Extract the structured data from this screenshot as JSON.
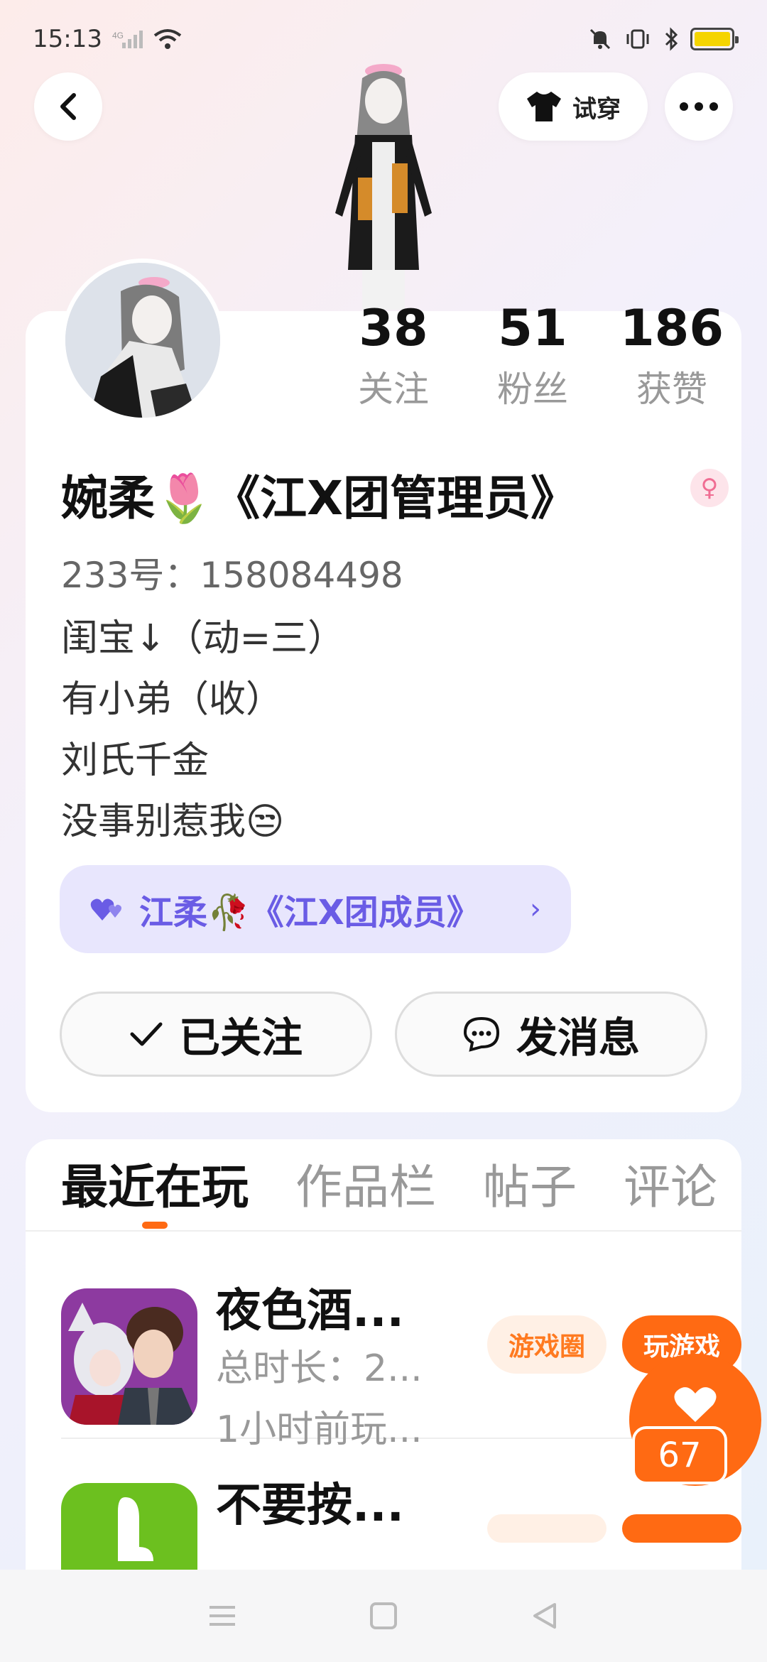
{
  "status_bar": {
    "time": "15:13"
  },
  "header": {
    "tryon_label": "试穿"
  },
  "stats": [
    {
      "value": "38",
      "label": "关注"
    },
    {
      "value": "51",
      "label": "粉丝"
    },
    {
      "value": "186",
      "label": "获赞"
    }
  ],
  "profile": {
    "name": "婉柔🌷《江X团管理员》",
    "uid": "233号：158084498",
    "bio_lines": [
      "闺宝↓（动=三）",
      "有小弟（收）",
      "刘氏千金",
      "没事别惹我😒"
    ],
    "group_label": "江柔🥀《江X团成员》"
  },
  "actions": {
    "follow_label": "已关注",
    "message_label": "发消息"
  },
  "tabs": [
    "最近在玩",
    "作品栏",
    "帖子",
    "评论"
  ],
  "games": [
    {
      "title": "夜色酒...",
      "duration": "总时长：2...",
      "last_played": "1小时前玩...",
      "circle_label": "游戏圈",
      "play_label": "玩游戏"
    },
    {
      "title": "不要按..."
    }
  ],
  "like_count": "67",
  "colors": {
    "accent": "#ff6a13",
    "group": "#6a5ce5"
  }
}
